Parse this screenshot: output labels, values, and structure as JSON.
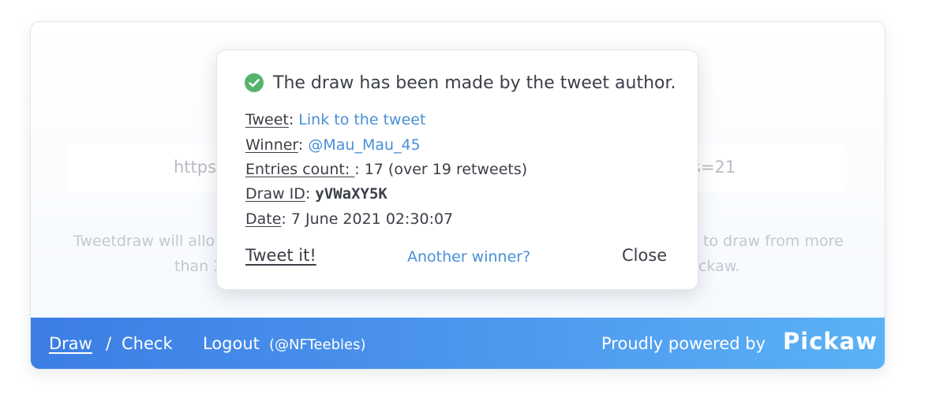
{
  "background": {
    "url_left": "https",
    "url_right": "s=21",
    "desc_left_1": "Tweetdraw will allo",
    "desc_left_2": "than 3",
    "desc_right_1": "to draw from more",
    "desc_right_2": "ckaw."
  },
  "modal": {
    "title": "The draw has been made by the tweet author.",
    "success_color": "#56b36b",
    "tweet_label": "Tweet",
    "tweet_link": "Link to the tweet",
    "winner_label": "Winner",
    "winner_value": "@Mau_Mau_45",
    "entries_label": "Entries count: ",
    "entries_value": "17 (over 19 retweets)",
    "draw_id_label": "Draw ID",
    "draw_id_value": "yVWaXY5K",
    "date_label": "Date",
    "date_value": "7 June 2021 02:30:07",
    "tweet_it": "Tweet it!",
    "another_winner": "Another winner?",
    "close": "Close"
  },
  "footer": {
    "draw": "Draw",
    "separator": "/",
    "check": "Check",
    "logout": "Logout",
    "handle": "(@NFTeebles)",
    "powered_by": "Proudly powered by",
    "brand": "Pickaw",
    "gradient_start": "#3c7ee4",
    "gradient_end": "#5ab2f5"
  }
}
